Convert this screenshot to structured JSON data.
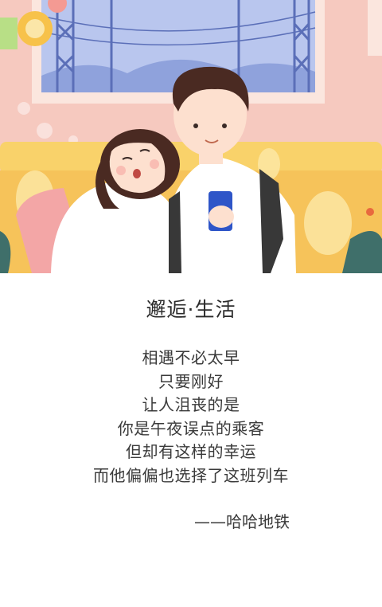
{
  "illustration": {
    "description_icon": "couple-on-train-illustration",
    "colors": {
      "wall": "#f6c9bf",
      "window_frame": "#fbe6de",
      "sky": "#b9c6ee",
      "bench": "#f9d26a",
      "shirt": "#ffffff",
      "hair": "#4a2a22",
      "skin": "#fde0cf",
      "phone": "#2e55c8"
    }
  },
  "article": {
    "title": "邂逅·生活",
    "lines": [
      "相遇不必太早",
      "只要刚好",
      "让人沮丧的是",
      "你是午夜误点的乘客",
      "但却有这样的幸运",
      "而他偏偏也选择了这班列车"
    ],
    "signature": "——哈哈地铁"
  }
}
